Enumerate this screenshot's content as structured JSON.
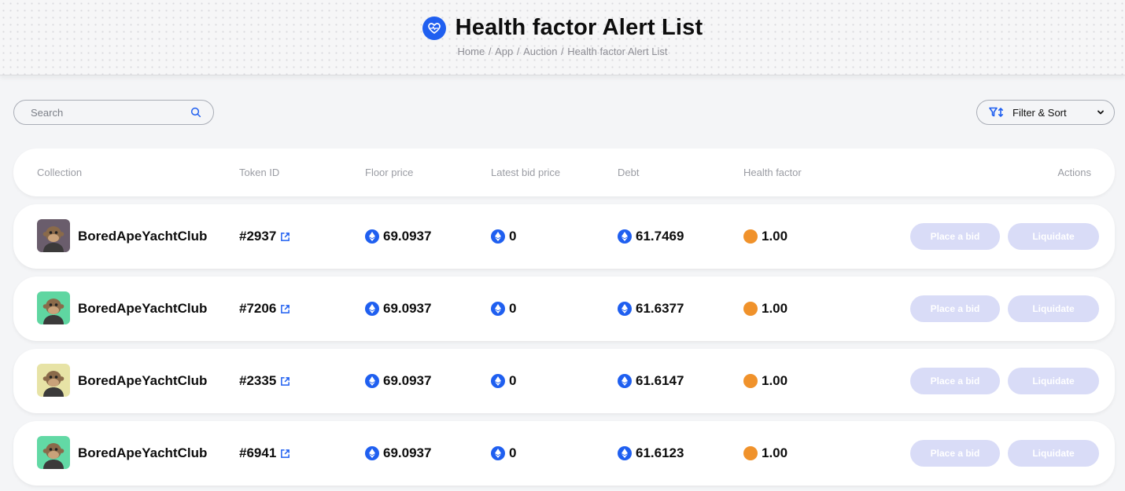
{
  "header": {
    "title": "Health factor Alert List",
    "title_icon": "heartbeat-icon",
    "breadcrumb": [
      "Home",
      "App",
      "Auction",
      "Health factor Alert List"
    ]
  },
  "search": {
    "placeholder": "Search",
    "icon": "search-icon"
  },
  "filter": {
    "label": "Filter & Sort",
    "icon": "filter-sort-icon"
  },
  "columns": {
    "collection": "Collection",
    "token_id": "Token ID",
    "floor_price": "Floor price",
    "latest_bid": "Latest bid price",
    "debt": "Debt",
    "health_factor": "Health factor",
    "actions": "Actions"
  },
  "actions": {
    "bid": "Place a bid",
    "liquidate": "Liquidate"
  },
  "colors": {
    "accent": "#1f5ff0",
    "health_dot": "#f0922b",
    "button_disabled": "#d9dcf7"
  },
  "rows": [
    {
      "collection": "BoredApeYachtClub",
      "token": "#2937",
      "floor": "69.0937",
      "bid": "0",
      "debt": "61.7469",
      "hf": "1.00",
      "avatar_bg": "#6a5d6c"
    },
    {
      "collection": "BoredApeYachtClub",
      "token": "#7206",
      "floor": "69.0937",
      "bid": "0",
      "debt": "61.6377",
      "hf": "1.00",
      "avatar_bg": "#5fd6a1"
    },
    {
      "collection": "BoredApeYachtClub",
      "token": "#2335",
      "floor": "69.0937",
      "bid": "0",
      "debt": "61.6147",
      "hf": "1.00",
      "avatar_bg": "#e7e3a6"
    },
    {
      "collection": "BoredApeYachtClub",
      "token": "#6941",
      "floor": "69.0937",
      "bid": "0",
      "debt": "61.6123",
      "hf": "1.00",
      "avatar_bg": "#62d9a5"
    }
  ]
}
